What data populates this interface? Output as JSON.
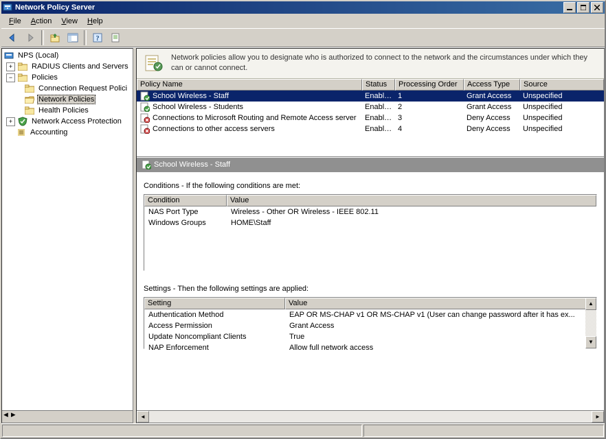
{
  "window": {
    "title": "Network Policy Server"
  },
  "menu": {
    "file": "File",
    "action": "Action",
    "view": "View",
    "help": "Help"
  },
  "tree": {
    "root": "NPS (Local)",
    "radius": "RADIUS Clients and Servers",
    "policies": "Policies",
    "conn_req": "Connection Request Polici",
    "net_pol": "Network Policies",
    "health": "Health Policies",
    "nap": "Network Access Protection",
    "accounting": "Accounting"
  },
  "banner": {
    "text": "Network policies allow you to designate who is authorized to connect to the network and the circumstances under which they can or cannot connect."
  },
  "cols": {
    "name": "Policy Name",
    "status": "Status",
    "order": "Processing Order",
    "access": "Access Type",
    "source": "Source"
  },
  "rows": [
    {
      "icon": "allow",
      "name": "School Wireless - Staff",
      "status": "Enabled",
      "order": "1",
      "access": "Grant Access",
      "source": "Unspecified"
    },
    {
      "icon": "allow",
      "name": "School Wireless - Students",
      "status": "Enabled",
      "order": "2",
      "access": "Grant Access",
      "source": "Unspecified"
    },
    {
      "icon": "deny",
      "name": "Connections to Microsoft Routing and Remote Access server",
      "status": "Enabled",
      "order": "3",
      "access": "Deny Access",
      "source": "Unspecified"
    },
    {
      "icon": "deny",
      "name": "Connections to other access servers",
      "status": "Enabled",
      "order": "4",
      "access": "Deny Access",
      "source": "Unspecified"
    }
  ],
  "detail": {
    "title": "School Wireless - Staff"
  },
  "conditions": {
    "heading": "Conditions - If the following conditions are met:",
    "cols": {
      "c1": "Condition",
      "c2": "Value"
    },
    "rows": [
      {
        "c1": "NAS Port Type",
        "c2": "Wireless - Other OR Wireless - IEEE 802.11"
      },
      {
        "c1": "Windows Groups",
        "c2": "HOME\\Staff"
      }
    ]
  },
  "settings": {
    "heading": "Settings - Then the following settings are applied:",
    "cols": {
      "s1": "Setting",
      "s2": "Value"
    },
    "rows": [
      {
        "s1": "Authentication Method",
        "s2": "EAP OR MS-CHAP v1 OR MS-CHAP v1 (User can change password after it has ex..."
      },
      {
        "s1": "Access Permission",
        "s2": "Grant Access"
      },
      {
        "s1": "Update Noncompliant Clients",
        "s2": "True"
      },
      {
        "s1": "NAP Enforcement",
        "s2": "Allow full network access"
      }
    ]
  }
}
